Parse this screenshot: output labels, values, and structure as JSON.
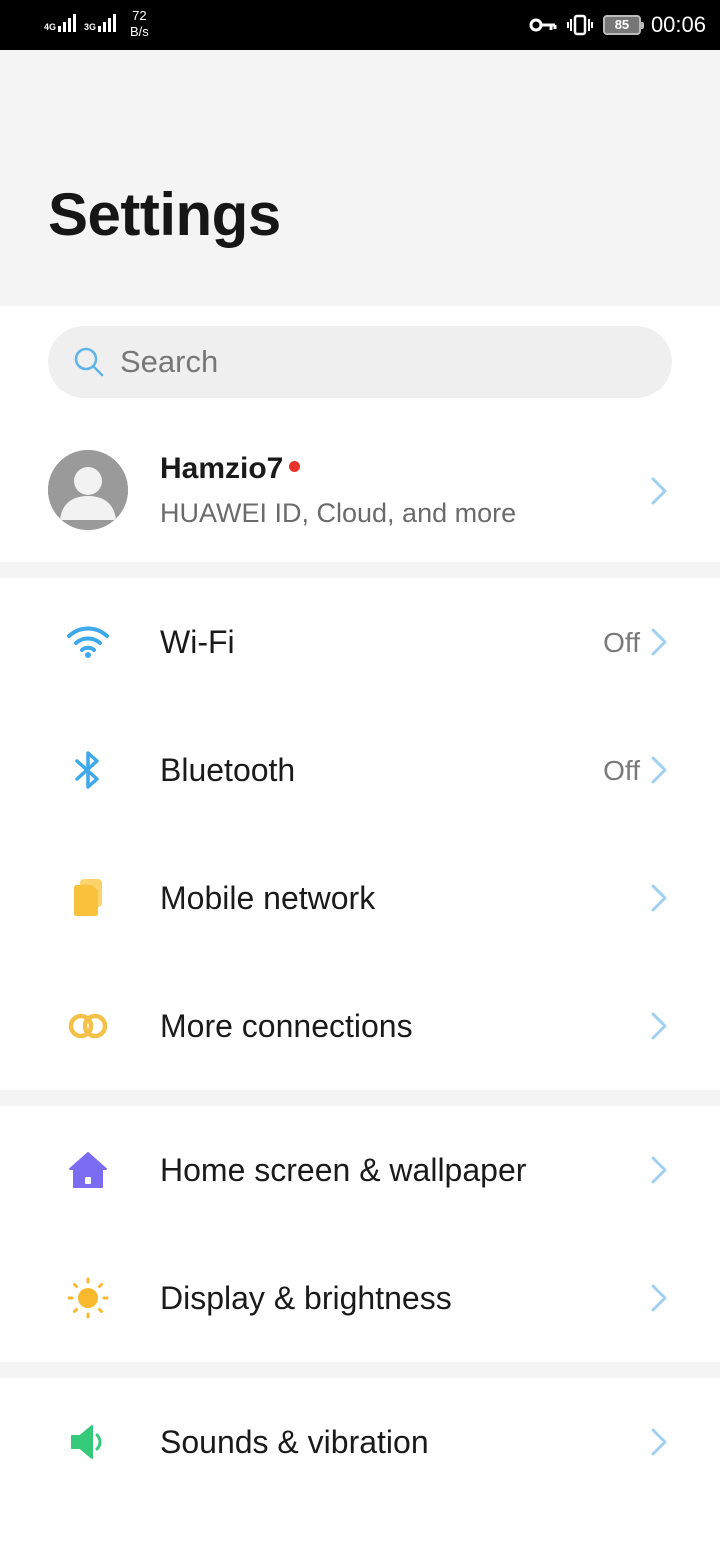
{
  "status_bar": {
    "sim1_net": "4G",
    "sim2_net": "3G",
    "speed_value": "72",
    "speed_unit": "B/s",
    "battery": "85",
    "time": "00:06",
    "icons": [
      "key-icon",
      "vibrate-icon",
      "battery-icon"
    ]
  },
  "header": {
    "title": "Settings"
  },
  "search": {
    "placeholder": "Search"
  },
  "account": {
    "name": "Hamzio7",
    "subtitle": "HUAWEI ID, Cloud, and more"
  },
  "sections": [
    {
      "items": [
        {
          "label": "Wi-Fi",
          "value": "Off",
          "icon": "wifi-icon",
          "color": "#3da9ea"
        },
        {
          "label": "Bluetooth",
          "value": "Off",
          "icon": "bluetooth-icon",
          "color": "#3da9ea"
        },
        {
          "label": "Mobile network",
          "value": "",
          "icon": "mobile-network-icon",
          "color": "#f8c23c"
        },
        {
          "label": "More connections",
          "value": "",
          "icon": "more-connections-icon",
          "color": "#f4c148"
        }
      ]
    },
    {
      "items": [
        {
          "label": "Home screen & wallpaper",
          "value": "",
          "icon": "home-icon",
          "color": "#7b6cf2"
        },
        {
          "label": "Display & brightness",
          "value": "",
          "icon": "sun-icon",
          "color": "#f8b92e"
        }
      ]
    },
    {
      "items": [
        {
          "label": "Sounds & vibration",
          "value": "",
          "icon": "speaker-icon",
          "color": "#35c97a"
        }
      ]
    }
  ],
  "colors": {
    "accent_chevron": "#9fd0ef",
    "notification_dot": "#e8342b"
  }
}
